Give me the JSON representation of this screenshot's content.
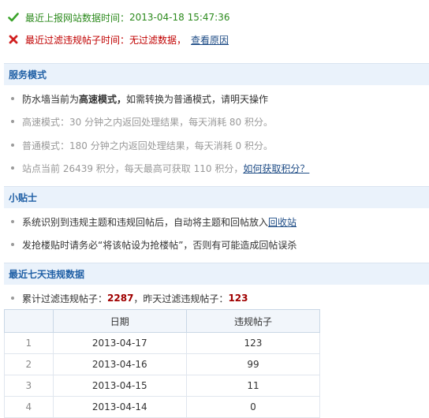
{
  "status": {
    "report_label": "最近上报网站数据时间：",
    "report_time": "2013-04-18 15:47:36",
    "filter_label": "最近过滤违规帖子时间：",
    "filter_value": "无过滤数据，",
    "filter_link": "查看原因"
  },
  "service": {
    "title": "服务模式",
    "mode_prefix": "防水墙当前为",
    "mode_bold": "高速模式，",
    "mode_suffix": "如需转换为普通模式，请明天操作",
    "fast_desc": "高速模式：30 分钟之内返回处理结果，每天消耗 80 积分。",
    "normal_desc": "普通模式：180 分钟之内返回处理结果，每天消耗 0 积分。",
    "points_desc": "站点当前 26439 积分，每天最高可获取 110 积分，",
    "points_link": "如何获取积分？"
  },
  "tips": {
    "title": "小贴士",
    "tip1_text": "系统识别到违规主题和违规回帖后，自动将主题和回帖放入 ",
    "tip1_link": "回收站",
    "tip2_text": "发抢楼贴时请务必“将该帖设为抢楼帖”，否则有可能造成回帖误杀"
  },
  "recent": {
    "title": "最近七天违规数据",
    "total_label": "累计过滤违规帖子：",
    "total_value": "2287",
    "yesterday_label": "，昨天过滤违规帖子：",
    "yesterday_value": "123",
    "table": {
      "headers": [
        "",
        "日期",
        "违规帖子"
      ],
      "rows": [
        {
          "idx": "1",
          "date": "2013-04-17",
          "count": "123"
        },
        {
          "idx": "2",
          "date": "2013-04-16",
          "count": "99"
        },
        {
          "idx": "3",
          "date": "2013-04-15",
          "count": "11"
        },
        {
          "idx": "4",
          "date": "2013-04-14",
          "count": "0"
        }
      ]
    }
  },
  "colors": {
    "ok": "#2c8a1d",
    "error": "#c00000",
    "header_bg": "#eaf2fb",
    "header_text": "#1f5fa5",
    "link": "#1d4b85"
  }
}
